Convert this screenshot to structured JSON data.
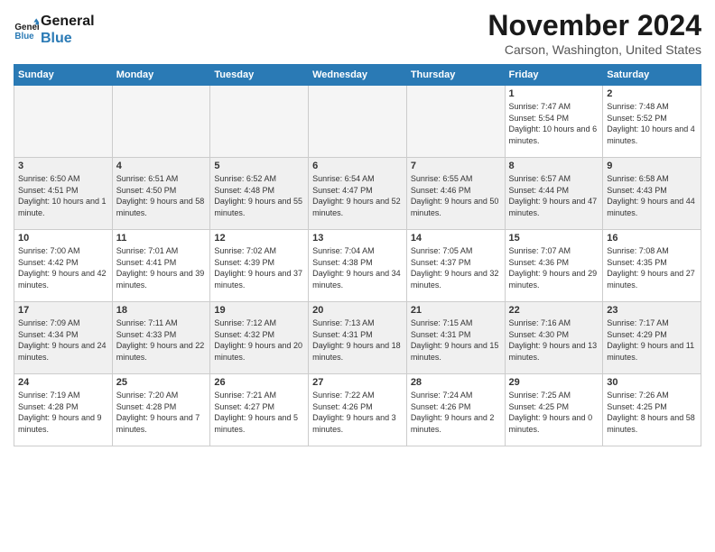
{
  "header": {
    "logo_line1": "General",
    "logo_line2": "Blue",
    "month_title": "November 2024",
    "location": "Carson, Washington, United States"
  },
  "days_of_week": [
    "Sunday",
    "Monday",
    "Tuesday",
    "Wednesday",
    "Thursday",
    "Friday",
    "Saturday"
  ],
  "weeks": [
    [
      {
        "day": "",
        "info": ""
      },
      {
        "day": "",
        "info": ""
      },
      {
        "day": "",
        "info": ""
      },
      {
        "day": "",
        "info": ""
      },
      {
        "day": "",
        "info": ""
      },
      {
        "day": "1",
        "info": "Sunrise: 7:47 AM\nSunset: 5:54 PM\nDaylight: 10 hours and 6 minutes."
      },
      {
        "day": "2",
        "info": "Sunrise: 7:48 AM\nSunset: 5:52 PM\nDaylight: 10 hours and 4 minutes."
      }
    ],
    [
      {
        "day": "3",
        "info": "Sunrise: 6:50 AM\nSunset: 4:51 PM\nDaylight: 10 hours and 1 minute."
      },
      {
        "day": "4",
        "info": "Sunrise: 6:51 AM\nSunset: 4:50 PM\nDaylight: 9 hours and 58 minutes."
      },
      {
        "day": "5",
        "info": "Sunrise: 6:52 AM\nSunset: 4:48 PM\nDaylight: 9 hours and 55 minutes."
      },
      {
        "day": "6",
        "info": "Sunrise: 6:54 AM\nSunset: 4:47 PM\nDaylight: 9 hours and 52 minutes."
      },
      {
        "day": "7",
        "info": "Sunrise: 6:55 AM\nSunset: 4:46 PM\nDaylight: 9 hours and 50 minutes."
      },
      {
        "day": "8",
        "info": "Sunrise: 6:57 AM\nSunset: 4:44 PM\nDaylight: 9 hours and 47 minutes."
      },
      {
        "day": "9",
        "info": "Sunrise: 6:58 AM\nSunset: 4:43 PM\nDaylight: 9 hours and 44 minutes."
      }
    ],
    [
      {
        "day": "10",
        "info": "Sunrise: 7:00 AM\nSunset: 4:42 PM\nDaylight: 9 hours and 42 minutes."
      },
      {
        "day": "11",
        "info": "Sunrise: 7:01 AM\nSunset: 4:41 PM\nDaylight: 9 hours and 39 minutes."
      },
      {
        "day": "12",
        "info": "Sunrise: 7:02 AM\nSunset: 4:39 PM\nDaylight: 9 hours and 37 minutes."
      },
      {
        "day": "13",
        "info": "Sunrise: 7:04 AM\nSunset: 4:38 PM\nDaylight: 9 hours and 34 minutes."
      },
      {
        "day": "14",
        "info": "Sunrise: 7:05 AM\nSunset: 4:37 PM\nDaylight: 9 hours and 32 minutes."
      },
      {
        "day": "15",
        "info": "Sunrise: 7:07 AM\nSunset: 4:36 PM\nDaylight: 9 hours and 29 minutes."
      },
      {
        "day": "16",
        "info": "Sunrise: 7:08 AM\nSunset: 4:35 PM\nDaylight: 9 hours and 27 minutes."
      }
    ],
    [
      {
        "day": "17",
        "info": "Sunrise: 7:09 AM\nSunset: 4:34 PM\nDaylight: 9 hours and 24 minutes."
      },
      {
        "day": "18",
        "info": "Sunrise: 7:11 AM\nSunset: 4:33 PM\nDaylight: 9 hours and 22 minutes."
      },
      {
        "day": "19",
        "info": "Sunrise: 7:12 AM\nSunset: 4:32 PM\nDaylight: 9 hours and 20 minutes."
      },
      {
        "day": "20",
        "info": "Sunrise: 7:13 AM\nSunset: 4:31 PM\nDaylight: 9 hours and 18 minutes."
      },
      {
        "day": "21",
        "info": "Sunrise: 7:15 AM\nSunset: 4:31 PM\nDaylight: 9 hours and 15 minutes."
      },
      {
        "day": "22",
        "info": "Sunrise: 7:16 AM\nSunset: 4:30 PM\nDaylight: 9 hours and 13 minutes."
      },
      {
        "day": "23",
        "info": "Sunrise: 7:17 AM\nSunset: 4:29 PM\nDaylight: 9 hours and 11 minutes."
      }
    ],
    [
      {
        "day": "24",
        "info": "Sunrise: 7:19 AM\nSunset: 4:28 PM\nDaylight: 9 hours and 9 minutes."
      },
      {
        "day": "25",
        "info": "Sunrise: 7:20 AM\nSunset: 4:28 PM\nDaylight: 9 hours and 7 minutes."
      },
      {
        "day": "26",
        "info": "Sunrise: 7:21 AM\nSunset: 4:27 PM\nDaylight: 9 hours and 5 minutes."
      },
      {
        "day": "27",
        "info": "Sunrise: 7:22 AM\nSunset: 4:26 PM\nDaylight: 9 hours and 3 minutes."
      },
      {
        "day": "28",
        "info": "Sunrise: 7:24 AM\nSunset: 4:26 PM\nDaylight: 9 hours and 2 minutes."
      },
      {
        "day": "29",
        "info": "Sunrise: 7:25 AM\nSunset: 4:25 PM\nDaylight: 9 hours and 0 minutes."
      },
      {
        "day": "30",
        "info": "Sunrise: 7:26 AM\nSunset: 4:25 PM\nDaylight: 8 hours and 58 minutes."
      }
    ]
  ]
}
